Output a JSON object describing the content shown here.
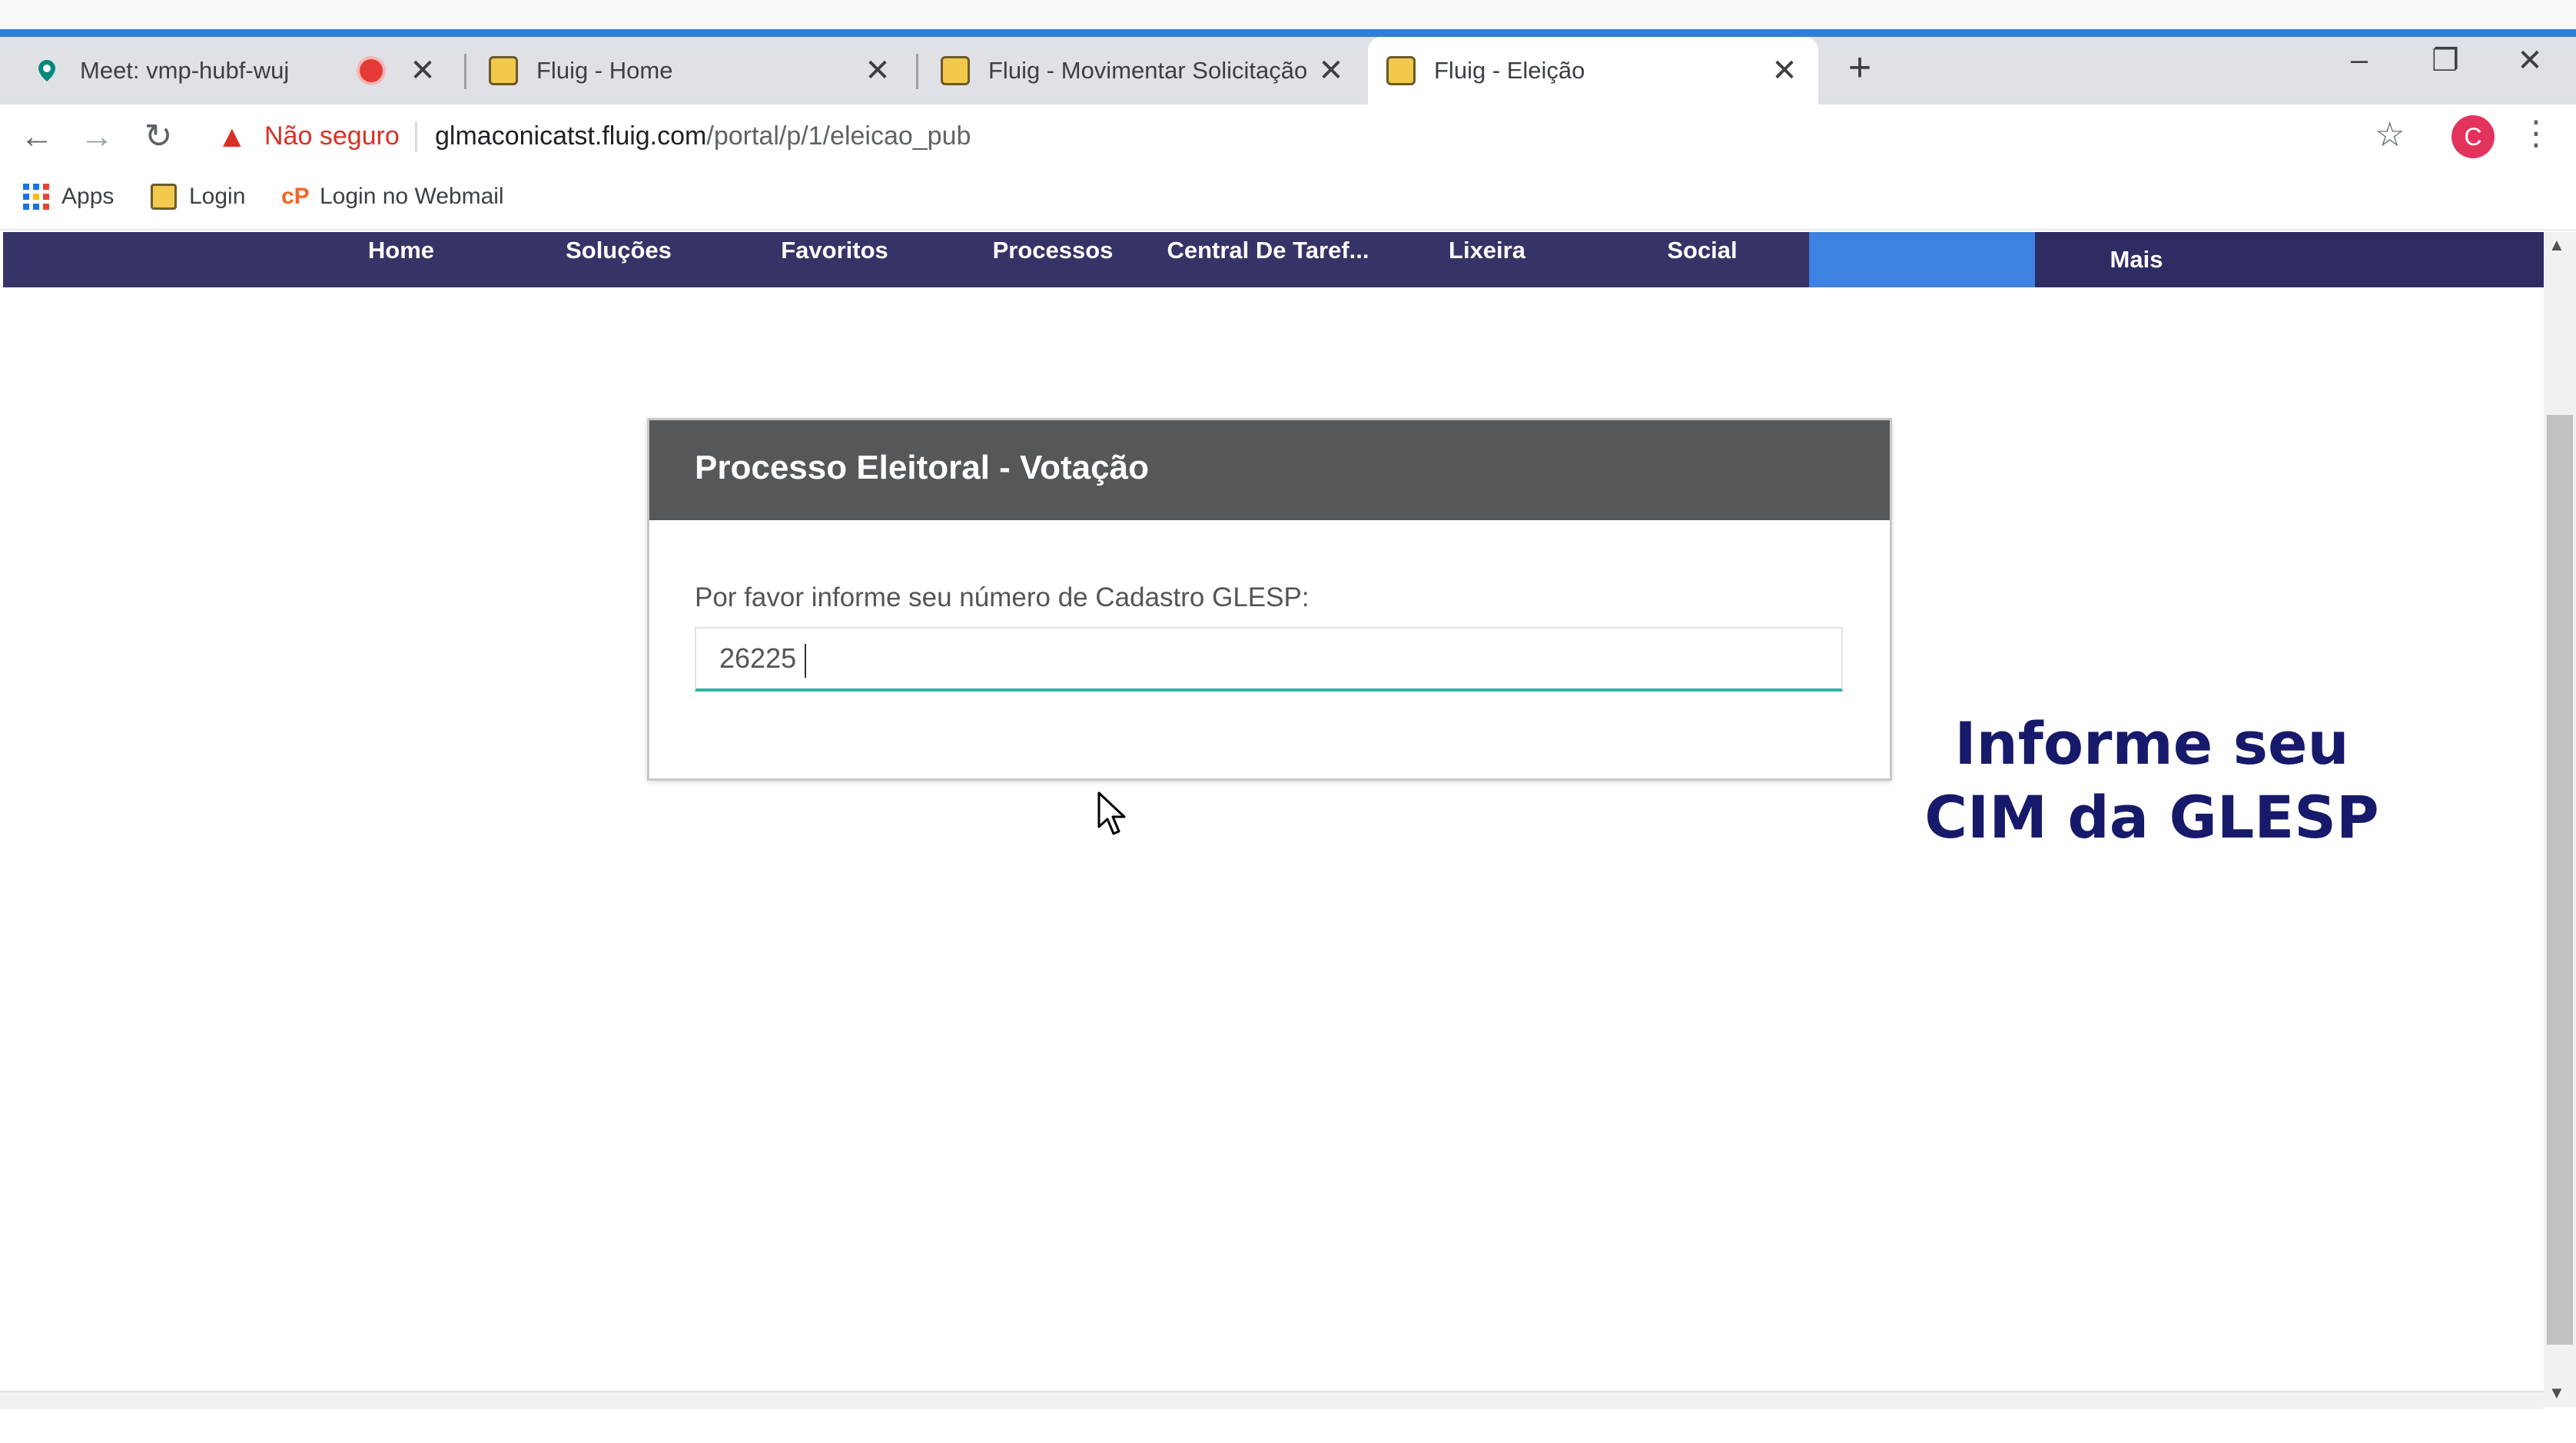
{
  "browser": {
    "tabs": [
      {
        "title": "Meet: vmp-hubf-wuj",
        "recording": true,
        "active": false
      },
      {
        "title": "Fluig - Home",
        "active": false
      },
      {
        "title": "Fluig - Movimentar Solicitação",
        "active": false
      },
      {
        "title": "Fluig - Eleição",
        "active": true
      }
    ],
    "new_tab_label": "+",
    "security_label": "Não seguro",
    "url_host": "glmaconicatst.fluig.com",
    "url_path": "/portal/p/1/eleicao_pub",
    "avatar_initial": "C",
    "bookmarks": [
      {
        "label": "Apps",
        "icon": "apps-grid-icon"
      },
      {
        "label": "Login",
        "icon": "fluig-favicon-icon"
      },
      {
        "label": "Login no Webmail",
        "icon": "webmail-icon"
      }
    ]
  },
  "fluig_nav": {
    "items": [
      "Home",
      "Soluções",
      "Favoritos",
      "Processos",
      "Central De Taref...",
      "Lixeira",
      "Social",
      "Mais"
    ]
  },
  "panel": {
    "title": "Processo Eleitoral - Votação",
    "label": "Por favor informe seu número de Cadastro GLESP:",
    "input_value": "26225"
  },
  "caption": {
    "line1": "Informe seu",
    "line2": "CIM da GLESP"
  },
  "colors": {
    "nav_bg": "#363366",
    "nav_active": "#3d82e0",
    "panel_header": "#555759",
    "input_focus": "#35b0a8",
    "caption_text": "#171a6b"
  }
}
